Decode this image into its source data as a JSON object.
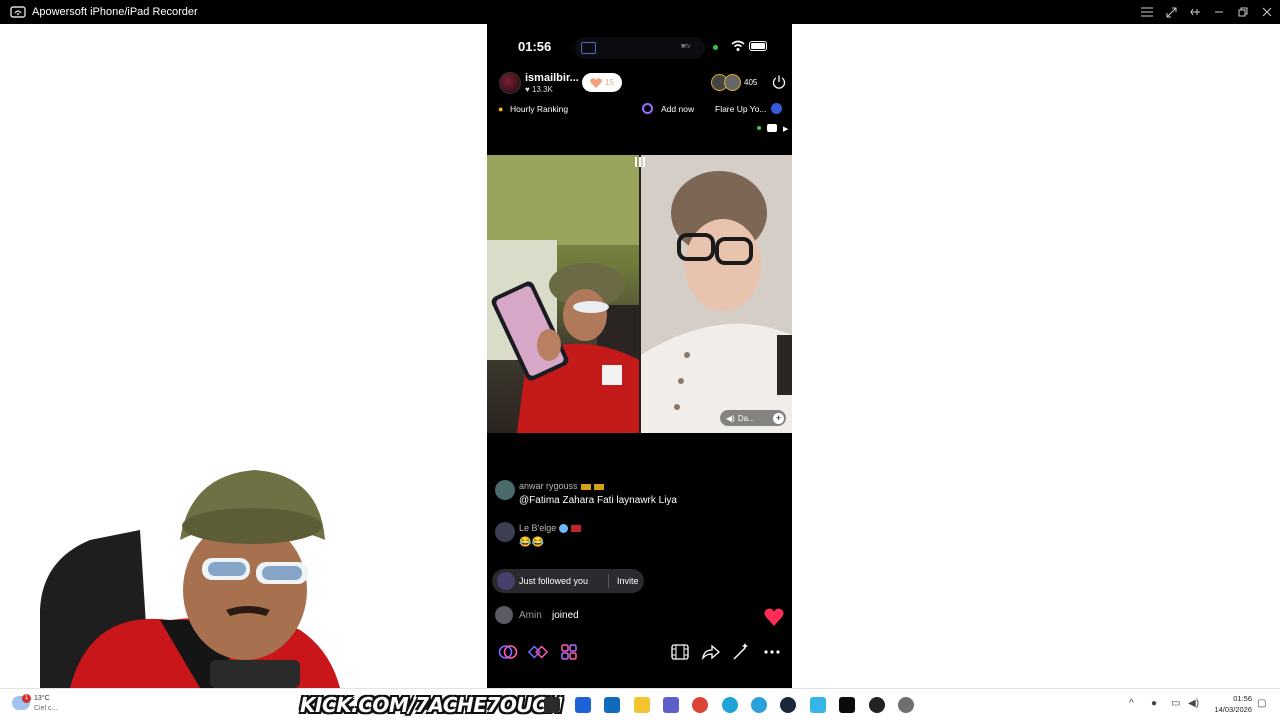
{
  "window": {
    "title": "Apowersoft iPhone/iPad Recorder",
    "controls": [
      "list",
      "fullscreen",
      "pin",
      "minimize",
      "restore",
      "close"
    ]
  },
  "phone": {
    "status": {
      "time": "01:56"
    },
    "host": {
      "name": "ismailbir...",
      "likes": "♥ 13.3K",
      "follow_count": "15"
    },
    "viewers": {
      "count": "405"
    },
    "ranking": {
      "hourly": "Hourly Ranking",
      "add_now": "Add now",
      "flare": "Flare Up Yo..."
    },
    "cohost_tag": "Da...",
    "comments": [
      {
        "user": "anwar rygouss",
        "text": "@Fatima Zahara Fati laynawrk Liya"
      },
      {
        "user": "Le B'elge",
        "text": "😂😂"
      }
    ],
    "followed": {
      "text": "Just followed you",
      "invite": "Invite"
    },
    "joined": {
      "user": "Amin",
      "text": "joined"
    }
  },
  "taskbar": {
    "weather": {
      "temp": "13°C",
      "condition": "Ciel c..."
    },
    "banner": "KICK.COM/7ACHE7OUCH",
    "clock": {
      "time": "01:56",
      "date": "14/03/2026"
    }
  },
  "colors": {
    "titlebar": "#000000",
    "phone_bg": "#000000",
    "accent_red": "#fe2c55",
    "ring_purple": "#9b6cff"
  }
}
